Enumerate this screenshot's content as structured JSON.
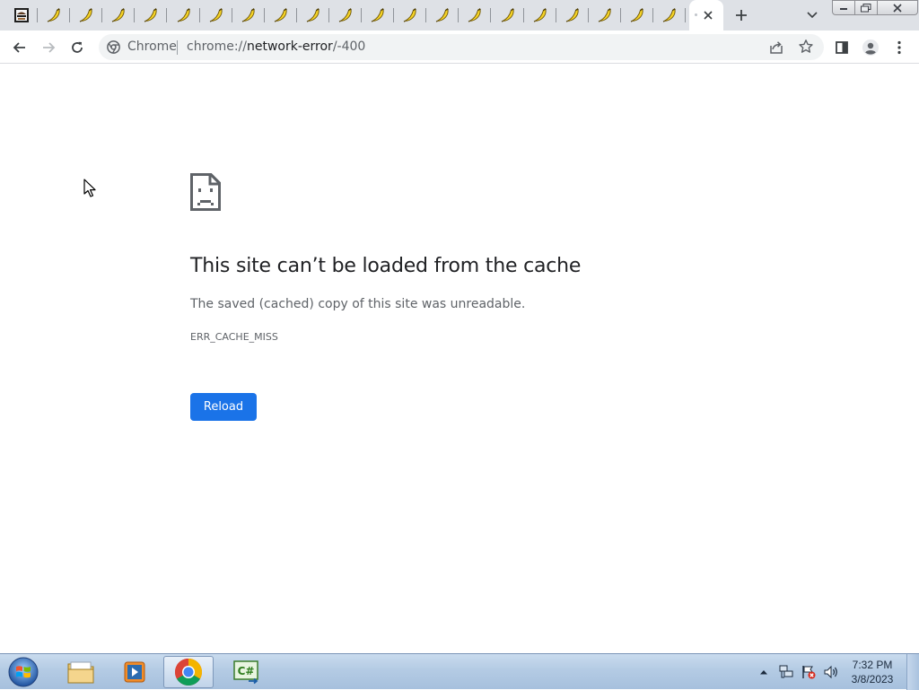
{
  "browser": {
    "tabs": [
      {
        "icon": "page-icon"
      },
      {
        "icon": "banana-icon"
      },
      {
        "icon": "banana-icon"
      },
      {
        "icon": "banana-icon"
      },
      {
        "icon": "banana-icon"
      },
      {
        "icon": "banana-icon"
      },
      {
        "icon": "banana-icon"
      },
      {
        "icon": "banana-icon"
      },
      {
        "icon": "banana-icon"
      },
      {
        "icon": "banana-icon"
      },
      {
        "icon": "banana-icon"
      },
      {
        "icon": "banana-icon"
      },
      {
        "icon": "banana-icon"
      },
      {
        "icon": "banana-icon"
      },
      {
        "icon": "banana-icon"
      },
      {
        "icon": "banana-icon"
      },
      {
        "icon": "banana-icon"
      },
      {
        "icon": "banana-icon"
      },
      {
        "icon": "banana-icon"
      },
      {
        "icon": "banana-icon"
      },
      {
        "icon": "banana-icon"
      }
    ],
    "omnibox": {
      "chip": "Chrome",
      "url_scheme": "chrome://",
      "url_host": "network-error",
      "url_path": "/-400"
    }
  },
  "error_page": {
    "title": "This site can’t be loaded from the cache",
    "description": "The saved (cached) copy of this site was unreadable.",
    "error_code": "ERR_CACHE_MISS",
    "reload_label": "Reload"
  },
  "taskbar": {
    "clock_time": "7:32 PM",
    "clock_date": "3/8/2023"
  },
  "colors": {
    "accent": "#1a73e8",
    "tabstrip": "#dee1e6",
    "omnibox": "#f1f3f4",
    "banana": "#f5d327"
  }
}
